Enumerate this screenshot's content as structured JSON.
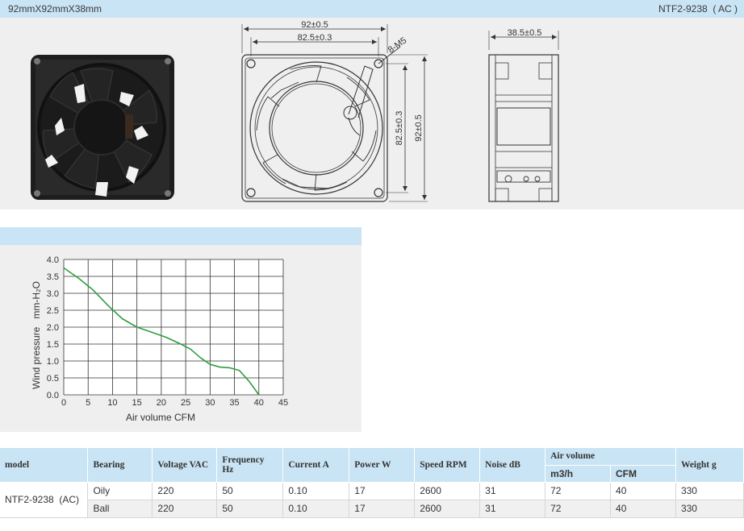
{
  "header": {
    "size_label": "92mmX92mmX38mm",
    "model_label": "NTF2-9238  ( AC )"
  },
  "drawing": {
    "front": {
      "outer_width": "92±0.5",
      "hole_width": "82.5±0.3",
      "hole_height": "82.5±0.3",
      "outer_height": "92±0.5",
      "screw": "8-M5"
    },
    "side": {
      "depth": "38.5±0.5"
    }
  },
  "chart_data": {
    "type": "line",
    "xlabel": "Air volume CFM",
    "ylabel": "Wind pressure   mm-H₂O",
    "xlim": [
      0,
      45
    ],
    "ylim": [
      0,
      4.0
    ],
    "x_ticks": [
      "0",
      "5",
      "10",
      "15",
      "20",
      "25",
      "30",
      "35",
      "40",
      "45"
    ],
    "y_ticks": [
      "0.0",
      "0.5",
      "1.0",
      "1.5",
      "2.0",
      "2.5",
      "3.0",
      "3.5",
      "4.0"
    ],
    "grid": true,
    "color": "#2e9e3e",
    "series": [
      {
        "x": [
          0,
          3,
          6,
          9,
          12,
          15,
          18,
          21,
          24,
          26,
          28,
          30,
          32,
          34,
          36,
          38,
          40
        ],
        "y": [
          3.75,
          3.45,
          3.1,
          2.65,
          2.25,
          2.0,
          1.85,
          1.7,
          1.5,
          1.35,
          1.1,
          0.9,
          0.82,
          0.8,
          0.72,
          0.4,
          0.0
        ]
      }
    ]
  },
  "table": {
    "headers": {
      "model": "model",
      "bearing": "Bearing",
      "voltage": "Voltage VAC",
      "frequency": "Frequency Hz",
      "current": "Current A",
      "power": "Power W",
      "speed": "Speed RPM",
      "noise": "Noise dB",
      "air_volume": "Air volume",
      "m3h": "m3/h",
      "cfm": "CFM",
      "weight": "Weight g"
    },
    "model": "NTF2-9238  (AC)",
    "rows": [
      {
        "bearing": "Oily",
        "voltage": "220",
        "frequency": "50",
        "current": "0.10",
        "power": "17",
        "speed": "2600",
        "noise": "31",
        "m3h": "72",
        "cfm": "40",
        "weight": "330"
      },
      {
        "bearing": "Ball",
        "voltage": "220",
        "frequency": "50",
        "current": "0.10",
        "power": "17",
        "speed": "2600",
        "noise": "31",
        "m3h": "72",
        "cfm": "40",
        "weight": "330"
      }
    ]
  }
}
